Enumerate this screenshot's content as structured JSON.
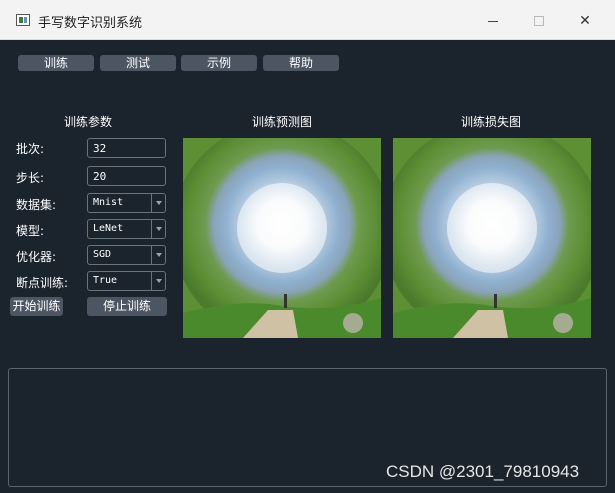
{
  "window": {
    "title": "手写数字识别系统"
  },
  "menu": {
    "train": "训练",
    "test": "测试",
    "example": "示例",
    "help": "帮助"
  },
  "params": {
    "title": "训练参数",
    "batch_label": "批次:",
    "batch_value": "32",
    "step_label": "步长:",
    "step_value": "20",
    "dataset_label": "数据集:",
    "dataset_value": "Mnist",
    "model_label": "模型:",
    "model_value": "LeNet",
    "optimizer_label": "优化器:",
    "optimizer_value": "SGD",
    "resume_label": "断点训练:",
    "resume_value": "True",
    "start_button": "开始训练",
    "stop_button": "停止训练"
  },
  "panels": {
    "prediction_title": "训练预测图",
    "loss_title": "训练损失图"
  },
  "watermark": "CSDN @2301_79810943",
  "colors": {
    "background": "#1b232d",
    "button": "#4c5562",
    "titlebar": "#f3f3f3"
  }
}
